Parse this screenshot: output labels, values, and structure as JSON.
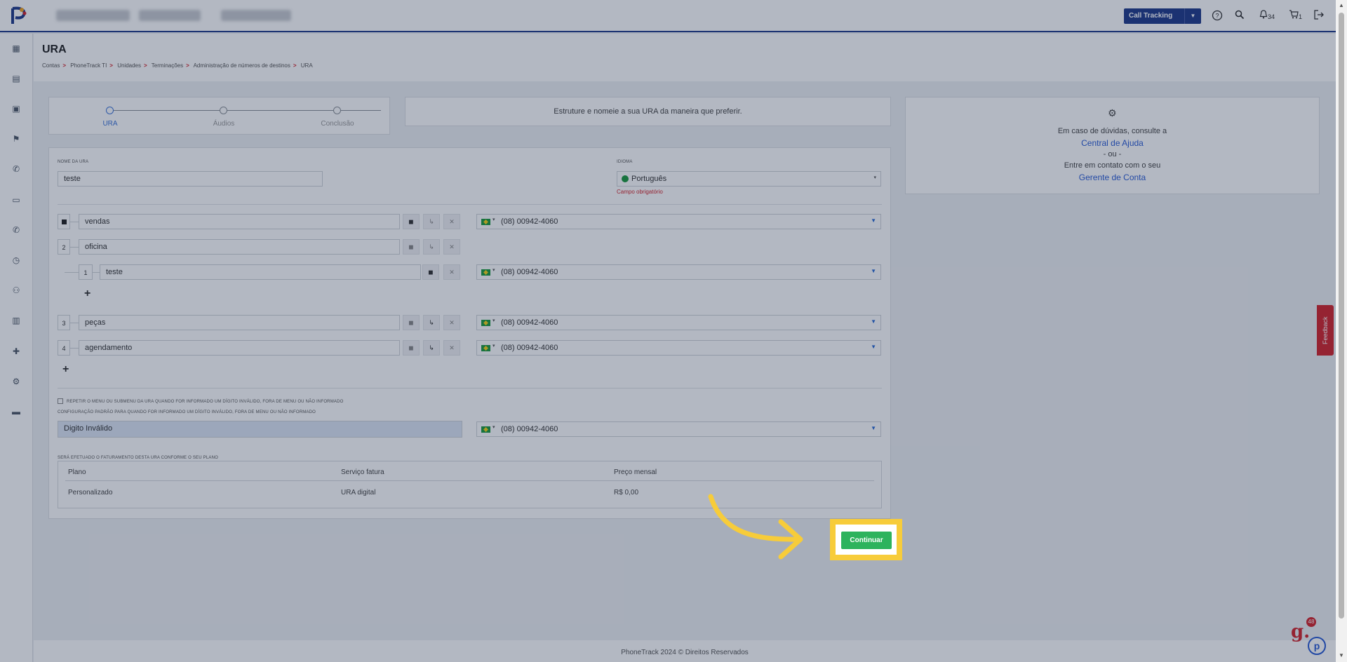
{
  "header": {
    "title": "URA",
    "breadcrumbs": [
      "Contas",
      "PhoneTrack TI",
      "Unidades",
      "Terminações",
      "Administração de números de destinos",
      "URA"
    ]
  },
  "topbar": {
    "product_button": "Call Tracking",
    "notifications_count": "34",
    "cart_count": "1"
  },
  "stepper": {
    "steps": [
      "URA",
      "Áudios",
      "Conclusão"
    ]
  },
  "info_box": {
    "text": "Estruture e nomeie a sua URA da maneira que preferir."
  },
  "form": {
    "name_label": "Nome da URA",
    "name_value": "teste",
    "language_label": "Idioma",
    "language_value": "Português",
    "language_error": "Campo obrigatório",
    "menu_items": [
      {
        "badge": "",
        "label": "vendas",
        "phone": "(08) 00942-4060"
      },
      {
        "badge": "2",
        "label": "oficina",
        "phone": ""
      },
      {
        "badge": "1",
        "label": "teste",
        "phone": "(08) 00942-4060"
      },
      {
        "badge": "3",
        "label": "peças",
        "phone": "(08) 00942-4060"
      },
      {
        "badge": "4",
        "label": "agendamento",
        "phone": "(08) 00942-4060"
      }
    ],
    "repeat_menu_label": "Repetir o menu ou submenu da URA quando for informado um dígito inválido, fora de menu ou não informado",
    "default_config_label": "Configuração padrão para quando for informado um dígito inválido, fora de menu ou não informado",
    "invalid_digit_value": "Digito Inválido",
    "invalid_digit_phone": "(08) 00942-4060",
    "billing_label": "Será efetuado o faturamento desta URA conforme o seu plano"
  },
  "billing_table": {
    "headers": [
      "Plano",
      "Serviço fatura",
      "Preço mensal"
    ],
    "row": [
      "Personalizado",
      "URA digital",
      "R$ 0,00"
    ]
  },
  "help": {
    "line1": "Em caso de dúvidas, consulte a",
    "link1": "Central de Ajuda",
    "or": "- ou -",
    "line2": "Entre em contato com o seu",
    "link2": "Gerente de Conta"
  },
  "actions": {
    "continue": "Continuar"
  },
  "feedback": "Feedback",
  "footer": "PhoneTrack 2024 © Direitos Reservados",
  "chat_badge_count": "48",
  "colors": {
    "primary": "#1f3a8a",
    "continue": "#2db35d",
    "highlight": "#f7cc3a",
    "error": "#d3242c"
  }
}
